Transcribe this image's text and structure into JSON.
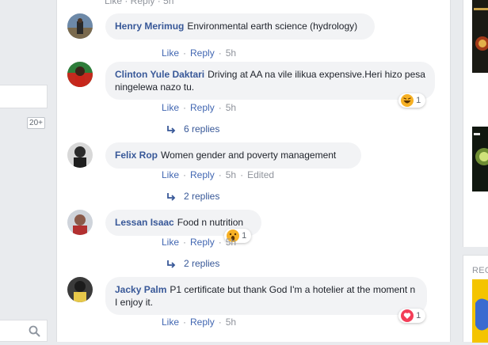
{
  "top_partial": "Like · Reply · 5h",
  "left_sidebar": {
    "badge": "20+"
  },
  "right_sidebar": {
    "section_label": "RECE"
  },
  "actions": {
    "like": "Like",
    "reply": "Reply",
    "dot": "·"
  },
  "comments": [
    {
      "author": "Henry Merimug",
      "text": "Environmental earth science (hydrology)",
      "time": "5h"
    },
    {
      "author": "Clinton Yule Daktari",
      "text": "Driving at AA na vile ilikua expensive.Heri hizo pesa ningelewa nazo tu.",
      "time": "5h",
      "reaction": {
        "icon": "haha-icon",
        "count": "1"
      },
      "replies": "6 replies"
    },
    {
      "author": "Felix Rop",
      "text": "Women gender and poverty management",
      "time": "5h",
      "edited": "Edited",
      "replies": "2 replies"
    },
    {
      "author": "Lessan Isaac",
      "text": "Food n nutrition",
      "time": "5h",
      "reaction": {
        "icon": "wow-icon",
        "count": "1"
      },
      "replies": "2 replies"
    },
    {
      "author": "Jacky Palm",
      "text": "P1 certificate but thank God I'm a hotelier at the moment n I enjoy it.",
      "time": "5h",
      "reaction": {
        "icon": "love-icon",
        "count": "1"
      }
    }
  ],
  "colors": {
    "link": "#385898",
    "action": "#4267b2",
    "bubble": "#f2f3f5",
    "page_bg": "#e9ebee"
  }
}
